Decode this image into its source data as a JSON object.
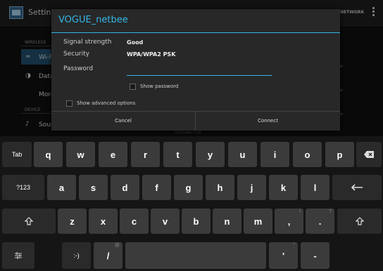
{
  "background": {
    "title": "Settings",
    "right_text": "NETWORK",
    "sections": {
      "wireless": "WIRELESS",
      "device": "DEVICE"
    },
    "items": [
      "Wi-Fi",
      "Data",
      "More",
      "Sound"
    ],
    "bottom_text": "ChinaB2750"
  },
  "dialog": {
    "title": "VOGUE_netbee",
    "signal_label": "Signal strength",
    "signal_value": "Good",
    "security_label": "Security",
    "security_value": "WPA/WPA2 PSK",
    "password_label": "Password",
    "password_value": "",
    "show_password": "Show password",
    "show_advanced": "Show advanced options",
    "cancel": "Cancel",
    "connect": "Connect"
  },
  "keyboard": {
    "row1": [
      "Tab",
      "q",
      "w",
      "e",
      "r",
      "t",
      "y",
      "u",
      "i",
      "o",
      "p"
    ],
    "row2": [
      "?123",
      "a",
      "s",
      "d",
      "f",
      "g",
      "h",
      "j",
      "k",
      "l"
    ],
    "row3": [
      "z",
      "x",
      "c",
      "v",
      "b",
      "n",
      "m",
      ",",
      "."
    ],
    "row3_sups": [
      "!",
      "?"
    ],
    "row4": [
      ":-)",
      "/",
      "'",
      "-"
    ],
    "row4_sups": [
      "@",
      "\""
    ],
    "icons": {
      "backspace": "backspace-icon",
      "enter": "enter-icon",
      "shift": "shift-icon",
      "settings": "keyboard-settings-icon"
    }
  },
  "colors": {
    "accent": "#33b5e5",
    "key": "#3b3b3b",
    "dialog": "#282828"
  }
}
